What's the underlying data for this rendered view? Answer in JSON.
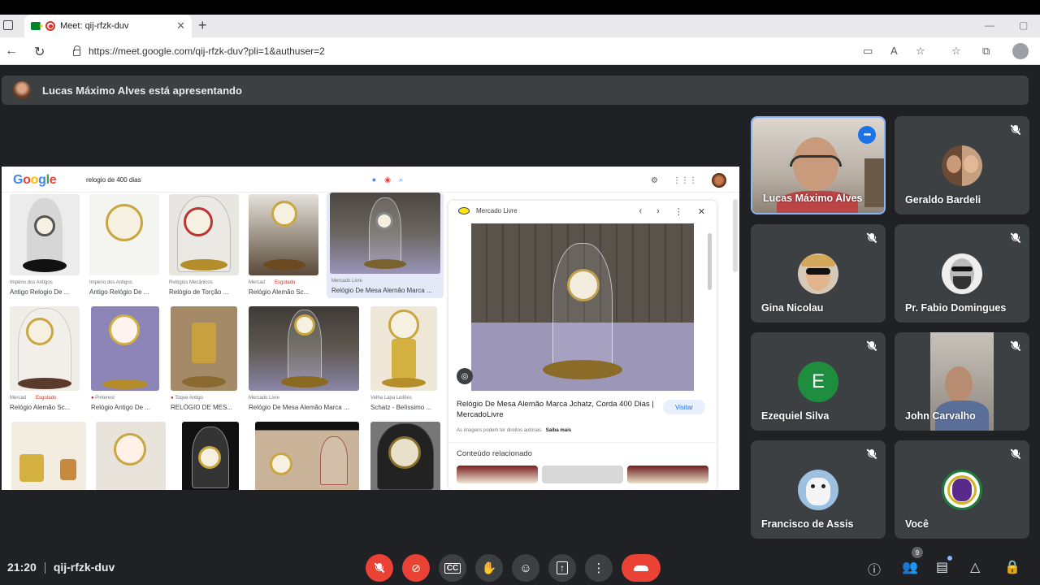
{
  "browser": {
    "tab_title": "Meet: qij-rfzk-duv",
    "url": "https://meet.google.com/qij-rfzk-duv?pli=1&authuser=2"
  },
  "banner": {
    "text": "Lucas Máximo Alves está apresentando"
  },
  "shared_screen": {
    "logo": "Google",
    "query": "relogio de 400 dias",
    "results": [
      {
        "source": "Império dos Antigos",
        "caption": "Antigo Relogio De ..."
      },
      {
        "source": "Império dos Antigos",
        "caption": "Antigo Relógio De ..."
      },
      {
        "source": "Relógios Mecânicos",
        "caption": "Relógio de Torção ..."
      },
      {
        "source": "Mercad",
        "badge": "Esgotado",
        "caption": "Relógio Alemão Sc..."
      },
      {
        "source": "Mercado Livre",
        "caption": "Relógio De Mesa Alemão Marca ..."
      },
      {
        "source": "Mercad",
        "badge": "Esgotado",
        "caption": "Relógio Alemão Sc..."
      },
      {
        "source": "Pinterest",
        "caption": "Relógio Antigo De ..."
      },
      {
        "source": "Toque Antigo",
        "caption": "RELÓGIO DE MES..."
      },
      {
        "source": "Mercado Livre",
        "caption": "Relógio De Mesa Alemão Marca ..."
      },
      {
        "source": "Velha Lapa Leilões",
        "caption": "Schatz - Belíssimo ..."
      }
    ],
    "panel": {
      "source": "Mercado Livre",
      "title": "Relógio De Mesa Alemão Marca Jchatz, Corda 400 Dias | MercadoLivre",
      "visit": "Visitar",
      "rights": "As imagens podem ter direitos autorais.",
      "learn_more": "Saiba mais",
      "related": "Conteúdo relacionado"
    }
  },
  "participants": [
    {
      "name": "Lucas Máximo Alves",
      "type": "video",
      "speaking": true
    },
    {
      "name": "Geraldo Bardeli",
      "type": "avatar"
    },
    {
      "name": "Gina Nicolau",
      "type": "avatar"
    },
    {
      "name": "Pr. Fabio Domingues",
      "type": "avatar"
    },
    {
      "name": "Ezequiel Silva",
      "type": "initial",
      "initial": "E",
      "color": "#1e8e3e"
    },
    {
      "name": "John Carvalho",
      "type": "video"
    },
    {
      "name": "Francisco de Assis",
      "type": "avatar"
    },
    {
      "name": "Você",
      "type": "avatar"
    }
  ],
  "bottom": {
    "time": "21:20",
    "meeting_code": "qij-rfzk-duv",
    "people_count": "9"
  },
  "colors": {
    "background": "#202124",
    "tile": "#3c4043",
    "danger": "#ea4335",
    "accent": "#8ab4f8"
  }
}
